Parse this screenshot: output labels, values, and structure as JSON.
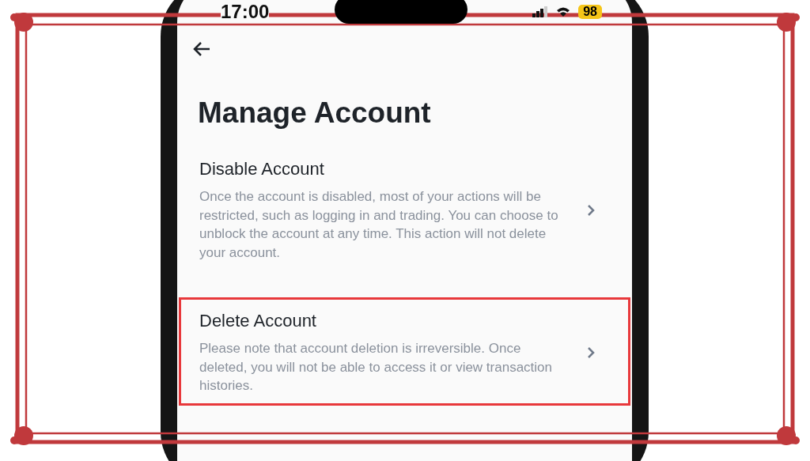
{
  "status_bar": {
    "time": "17:00",
    "battery": "98"
  },
  "title": "Manage Account",
  "options": [
    {
      "title": "Disable Account",
      "description": "Once the account is disabled, most of your actions will be restricted, such as logging in and trading. You can choose to unblock the account at any time. This action will not delete your account.",
      "highlighted": false
    },
    {
      "title": "Delete Account",
      "description": "Please note that account deletion is irreversible. Once deleted, you will not be able to access it or view transaction histories.",
      "highlighted": true
    }
  ]
}
